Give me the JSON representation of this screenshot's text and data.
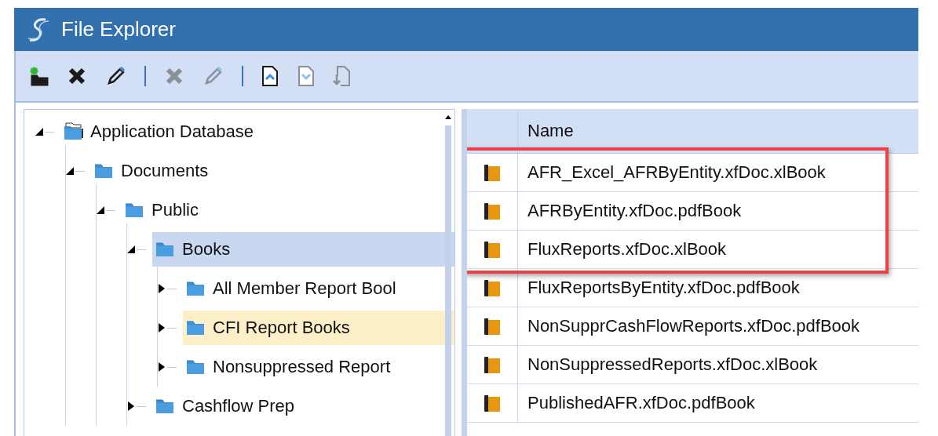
{
  "window": {
    "title": "File Explorer"
  },
  "toolbar": [
    {
      "kind": "button",
      "disabled": false
    },
    {
      "kind": "button",
      "disabled": false
    },
    {
      "kind": "button",
      "disabled": false
    },
    {
      "kind": "separator"
    },
    {
      "kind": "button",
      "disabled": true
    },
    {
      "kind": "button",
      "disabled": true
    },
    {
      "kind": "separator"
    },
    {
      "kind": "button",
      "disabled": false
    },
    {
      "kind": "button",
      "disabled": true
    },
    {
      "kind": "button",
      "disabled": true
    }
  ],
  "tree": [
    {
      "label": "Application Database",
      "kind": "database",
      "expanded": true,
      "selected": false,
      "hovered": false,
      "children": [
        {
          "label": "Documents",
          "kind": "folder",
          "expanded": true,
          "selected": false,
          "hovered": false,
          "children": [
            {
              "label": "Public",
              "kind": "folder",
              "expanded": true,
              "selected": false,
              "hovered": false,
              "children": [
                {
                  "label": "Books",
                  "kind": "folder",
                  "expanded": true,
                  "selected": true,
                  "hovered": false,
                  "children": [
                    {
                      "label": "All Member Report Bool",
                      "kind": "folder",
                      "expanded": false,
                      "selected": false,
                      "hovered": false
                    },
                    {
                      "label": "CFI Report Books",
                      "kind": "folder",
                      "expanded": false,
                      "selected": false,
                      "hovered": true
                    },
                    {
                      "label": "Nonsuppressed Report",
                      "kind": "folder",
                      "expanded": false,
                      "selected": false,
                      "hovered": false
                    }
                  ]
                },
                {
                  "label": "Cashflow Prep",
                  "kind": "folder",
                  "expanded": false,
                  "selected": false,
                  "hovered": false
                }
              ]
            }
          ]
        }
      ]
    }
  ],
  "table": {
    "columns": [
      "Name"
    ],
    "rows": [
      {
        "name": "AFR_Excel_AFRByEntity.xfDoc.xlBook",
        "highlighted": true
      },
      {
        "name": "AFRByEntity.xfDoc.pdfBook",
        "highlighted": true
      },
      {
        "name": "FluxReports.xfDoc.xlBook",
        "highlighted": true
      },
      {
        "name": "FluxReportsByEntity.xfDoc.pdfBook",
        "highlighted": false
      },
      {
        "name": "NonSupprCashFlowReports.xfDoc.pdfBook",
        "highlighted": false
      },
      {
        "name": "NonSuppressedReports.xfDoc.xlBook",
        "highlighted": false
      },
      {
        "name": "PublishedAFR.xfDoc.pdfBook",
        "highlighted": false
      }
    ]
  }
}
